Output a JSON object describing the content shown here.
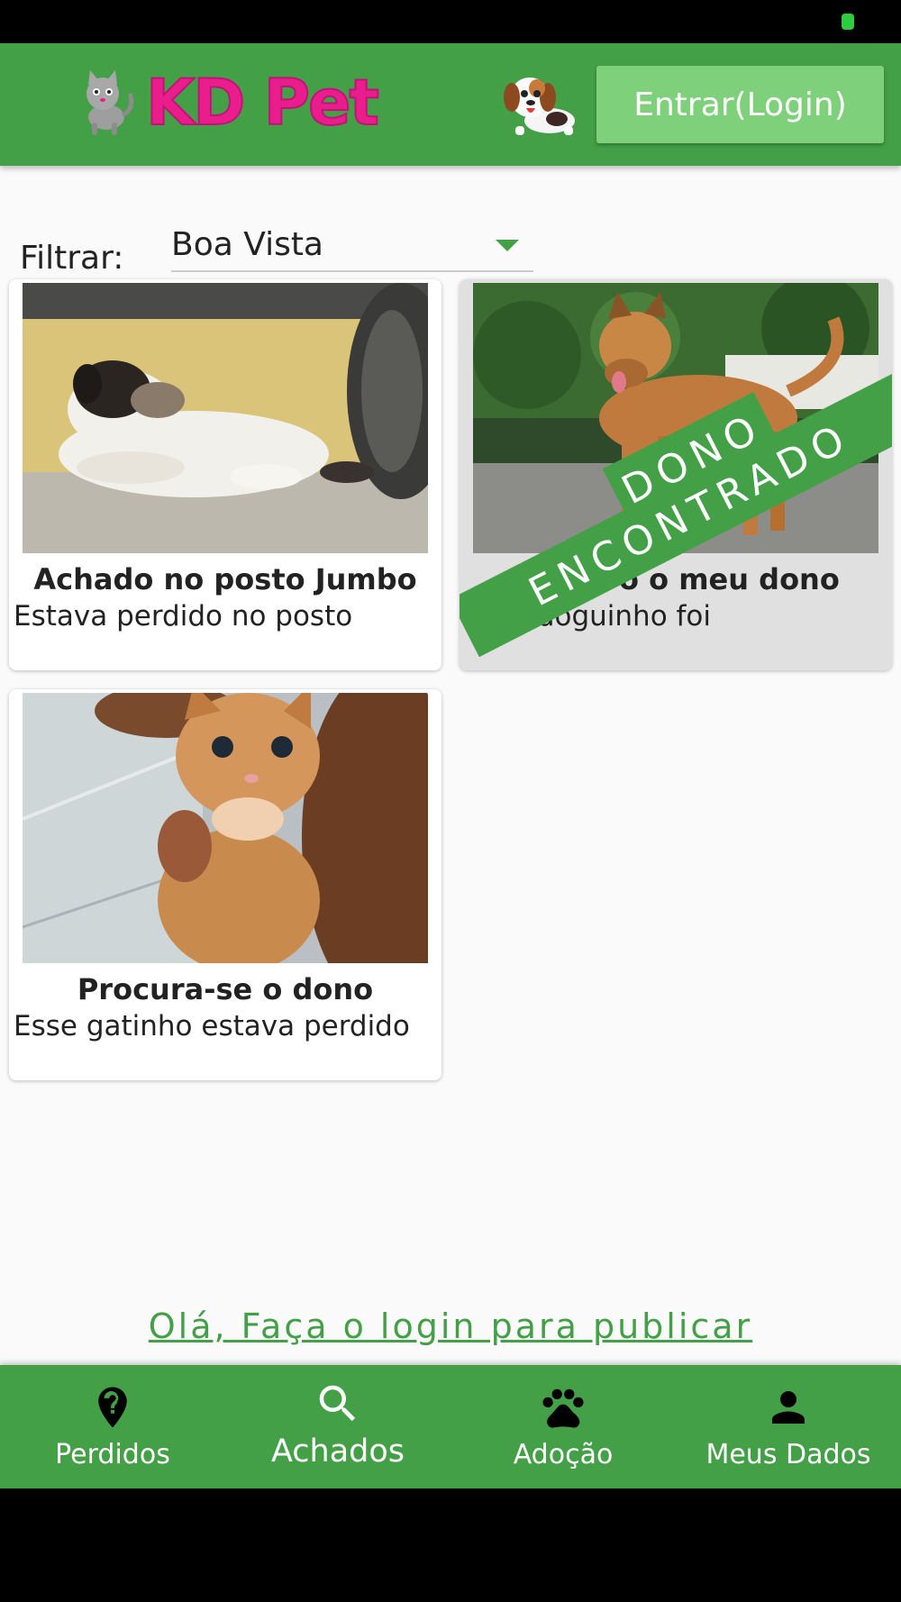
{
  "app": {
    "logo_text": "KD Pet",
    "login_label": "Entrar(Login)",
    "accent_color": "#43a047",
    "brand_color": "#e91e8c"
  },
  "filter": {
    "label": "Filtrar:",
    "value": "Boa Vista"
  },
  "cards": [
    {
      "title": "Achado no posto Jumbo",
      "description": "Estava perdido no posto",
      "status": ""
    },
    {
      "title": "Procuro o meu dono",
      "description": "Esse doguinho foi",
      "status": "found",
      "ribbon_line1": "DONO",
      "ribbon_line2": "ENCONTRADO"
    },
    {
      "title": "Procura-se o dono",
      "description": "Esse gatinho estava perdido",
      "status": ""
    }
  ],
  "login_prompt": "Olá, Faça o login para publicar",
  "bottom_nav": {
    "active": "Achados",
    "items": [
      {
        "label": "Perdidos",
        "icon": "location-question-icon"
      },
      {
        "label": "Achados",
        "icon": "search-icon"
      },
      {
        "label": "Adoção",
        "icon": "paw-icon"
      },
      {
        "label": "Meus Dados",
        "icon": "person-icon"
      }
    ]
  }
}
